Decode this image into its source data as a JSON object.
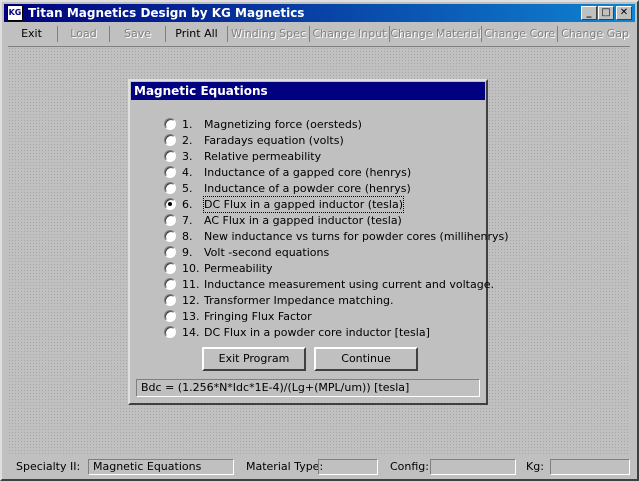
{
  "window": {
    "icon_text": "KG",
    "title": "Titan Magnetics Design by KG Magnetics",
    "minimize": "_",
    "maximize": "□",
    "close": "✕"
  },
  "menu": {
    "items": [
      {
        "label": "Exit",
        "enabled": true
      },
      {
        "label": "Load",
        "enabled": false
      },
      {
        "label": "Save",
        "enabled": false
      },
      {
        "label": "Print All",
        "enabled": true
      },
      {
        "label": "Winding Spec",
        "enabled": false
      },
      {
        "label": "Change Input",
        "enabled": false
      },
      {
        "label": "Change Material",
        "enabled": false
      },
      {
        "label": "Change Core",
        "enabled": false
      },
      {
        "label": "Change Gap",
        "enabled": false
      }
    ]
  },
  "dialog": {
    "title": "Magnetic Equations",
    "options": [
      {
        "num": "1.",
        "label": "Magnetizing force (oersteds)",
        "checked": false
      },
      {
        "num": "2.",
        "label": "Faradays equation (volts)",
        "checked": false
      },
      {
        "num": "3.",
        "label": "Relative permeability",
        "checked": false
      },
      {
        "num": "4.",
        "label": "Inductance of a gapped core (henrys)",
        "checked": false
      },
      {
        "num": "5.",
        "label": "Inductance of a powder core (henrys)",
        "checked": false
      },
      {
        "num": "6.",
        "label": "DC Flux in a gapped inductor (tesla)",
        "checked": true
      },
      {
        "num": "7.",
        "label": "AC Flux in a gapped inductor (tesla)",
        "checked": false
      },
      {
        "num": "8.",
        "label": "New inductance vs turns for powder cores (millihenrys)",
        "checked": false
      },
      {
        "num": "9.",
        "label": "Volt -second equations",
        "checked": false
      },
      {
        "num": "10.",
        "label": "Permeability",
        "checked": false
      },
      {
        "num": "11.",
        "label": "Inductance measurement using current and voltage.",
        "checked": false
      },
      {
        "num": "12.",
        "label": "Transformer Impedance matching.",
        "checked": false
      },
      {
        "num": "13.",
        "label": "Fringing Flux Factor",
        "checked": false
      },
      {
        "num": "14.",
        "label": "DC Flux in a powder core inductor [tesla]",
        "checked": false
      }
    ],
    "exit_button": "Exit Program",
    "continue_button": "Continue",
    "formula": "Bdc = (1.256*N*Idc*1E-4)/(Lg+(MPL/um))  [tesla]"
  },
  "status": {
    "specialty_label": "Specialty II:",
    "specialty_value": "Magnetic Equations",
    "material_label": "Material Type:",
    "material_value": "",
    "config_label": "Config:",
    "config_value": "",
    "kg_label": "Kg:",
    "kg_value": ""
  }
}
